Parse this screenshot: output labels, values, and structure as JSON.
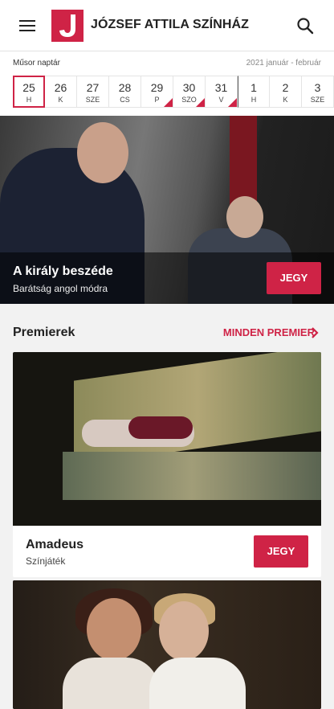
{
  "header": {
    "brand": "JÓZSEF ATTILA SZÍNHÁZ",
    "menu_icon": "hamburger-menu-icon",
    "search_icon": "search-icon",
    "accent_color": "#cf2346"
  },
  "calendar": {
    "title": "Műsor naptár",
    "range": "2021 január - február",
    "days": [
      {
        "num": "25",
        "name": "H"
      },
      {
        "num": "26",
        "name": "K"
      },
      {
        "num": "27",
        "name": "SZE"
      },
      {
        "num": "28",
        "name": "CS"
      },
      {
        "num": "29",
        "name": "P"
      },
      {
        "num": "30",
        "name": "SZO"
      },
      {
        "num": "31",
        "name": "V"
      },
      {
        "num": "1",
        "name": "H"
      },
      {
        "num": "2",
        "name": "K"
      },
      {
        "num": "3",
        "name": "SZE"
      }
    ]
  },
  "hero": {
    "title": "A király beszéde",
    "subtitle": "Barátság angol módra",
    "ticket_label": "JEGY"
  },
  "premieres": {
    "title": "Premierek",
    "link_label": "MINDEN PREMIER",
    "cards": [
      {
        "title": "Amadeus",
        "subtitle": "Színjáték",
        "ticket_label": "JEGY"
      }
    ]
  }
}
